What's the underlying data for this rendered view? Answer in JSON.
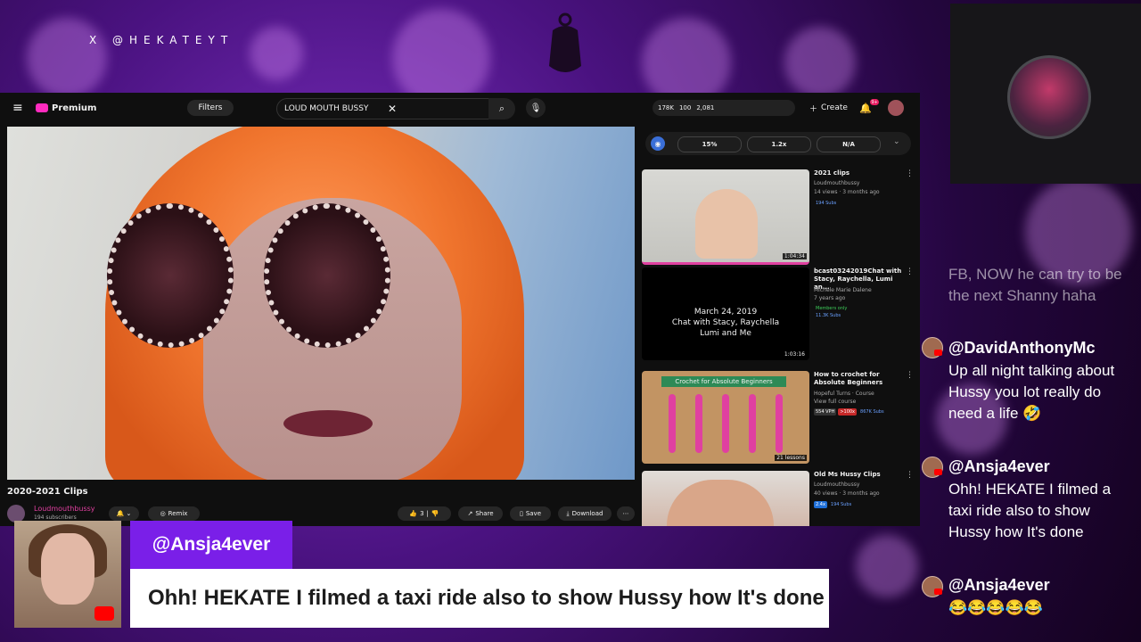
{
  "overlay_handle": "X @HEKATEYT",
  "youtube": {
    "brand": "Premium",
    "filters_label": "Filters",
    "search_query": "LOUD MOUTH BUSSY",
    "stats": {
      "views": "178K",
      "likes": "100",
      "count": "2,081"
    },
    "create_label": "Create",
    "notification_count": "9+"
  },
  "video": {
    "title": "2020-2021 Clips",
    "channel": "Loudmouthbussy",
    "subscribers": "194 subscribers",
    "remix_label": "Remix",
    "like_count": "3",
    "share_label": "Share",
    "save_label": "Save",
    "download_label": "Download"
  },
  "controls": {
    "pct": "15%",
    "speed": "1.2x",
    "na": "N/A"
  },
  "sidebar": [
    {
      "title": "2021 clips",
      "meta1": "Loudmouthbussy",
      "meta2": "14 views · 3 months ago",
      "badge": "194 Subs",
      "duration": "1:04:34"
    },
    {
      "title": "bcast03242019Chat with Stacy, Raychella, Lumi an...",
      "meta1": "Michele Marie Dalene",
      "meta2": "7 years ago",
      "badge": "Members only",
      "badge2": "11.3K Subs",
      "thumb_text": "March 24, 2019\nChat with Stacy, Raychella\nLumi and Me",
      "duration": "1:03:16"
    },
    {
      "title": "How to crochet for Absolute Beginners",
      "meta1": "Hopeful Turns · Course",
      "meta2": "View full course",
      "badge": "554 VPH",
      "badge2": ">100x",
      "badge3": "867K Subs",
      "thumb_text": "Crochet for Absolute Beginners",
      "duration": "21 lessons"
    },
    {
      "title": "Old Ms Hussy Clips",
      "meta1": "Loudmouthbussy",
      "meta2": "40 views · 3 months ago",
      "badge": "2.4x",
      "badge2": "194 Subs"
    }
  ],
  "chat": [
    {
      "user": "",
      "message": "FB, NOW he can try to be the next Shanny haha"
    },
    {
      "user": "@DavidAnthonyMc",
      "message": "Up all night talking about Hussy you lot really do need a life 🤣"
    },
    {
      "user": "@Ansja4ever",
      "message": "Ohh! HEKATE I filmed a taxi ride also to show Hussy how It's done"
    },
    {
      "user": "@Ansja4ever",
      "message": "😂😂😂😂😂"
    }
  ],
  "highlight": {
    "user": "@Ansja4ever",
    "message": "Ohh! HEKATE I filmed a taxi ride also to show Hussy how It's done"
  },
  "colors": {
    "accent": "#7a1fe8",
    "brand_pink": "#ff2bbf"
  }
}
